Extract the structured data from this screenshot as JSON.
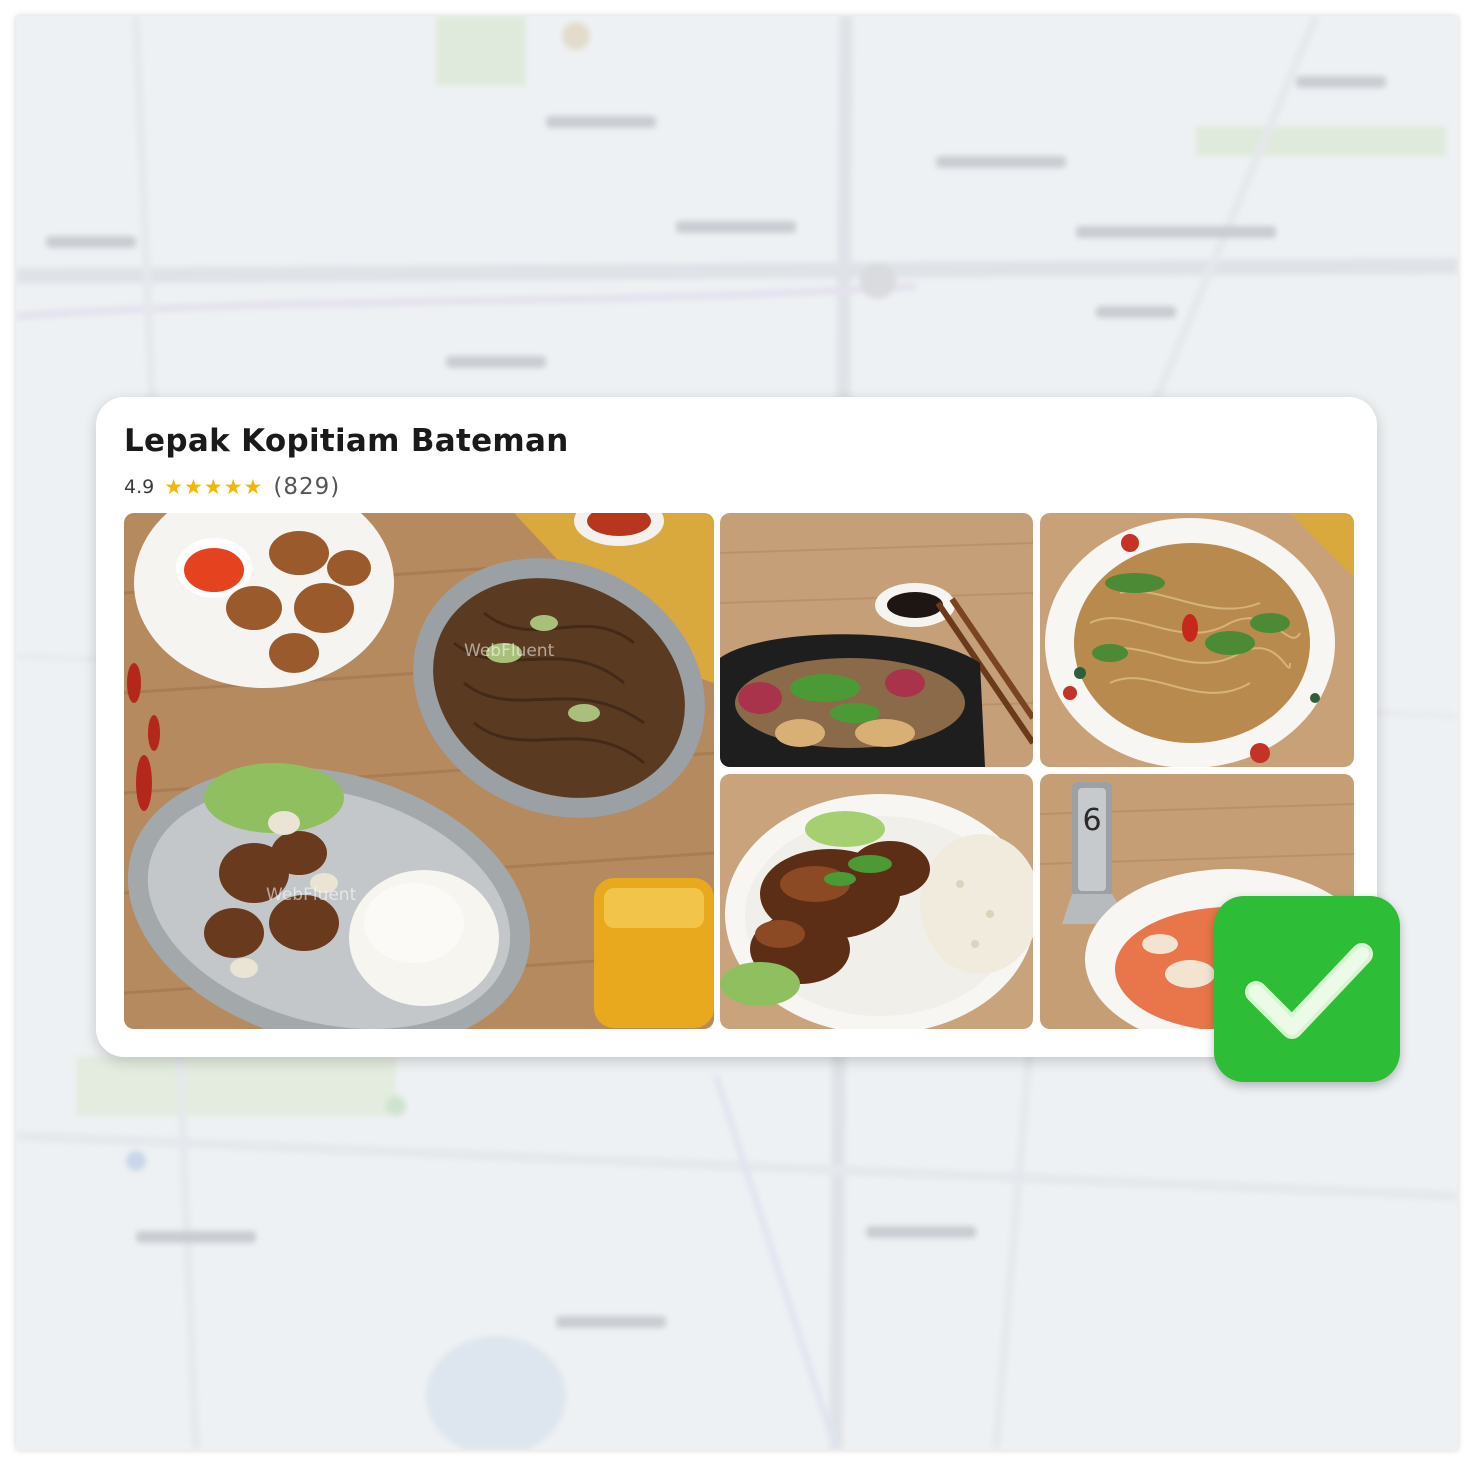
{
  "place": {
    "name": "Lepak Kopitiam Bateman",
    "rating": "4.9",
    "stars": "★★★★★",
    "review_count": "(829)"
  },
  "photos": {
    "watermark": "WebFluent"
  },
  "icons": {
    "verified": "checkmark-icon",
    "rating": "star-icon"
  },
  "colors": {
    "badge_green": "#2ebd36",
    "star_gold": "#f2b705"
  }
}
